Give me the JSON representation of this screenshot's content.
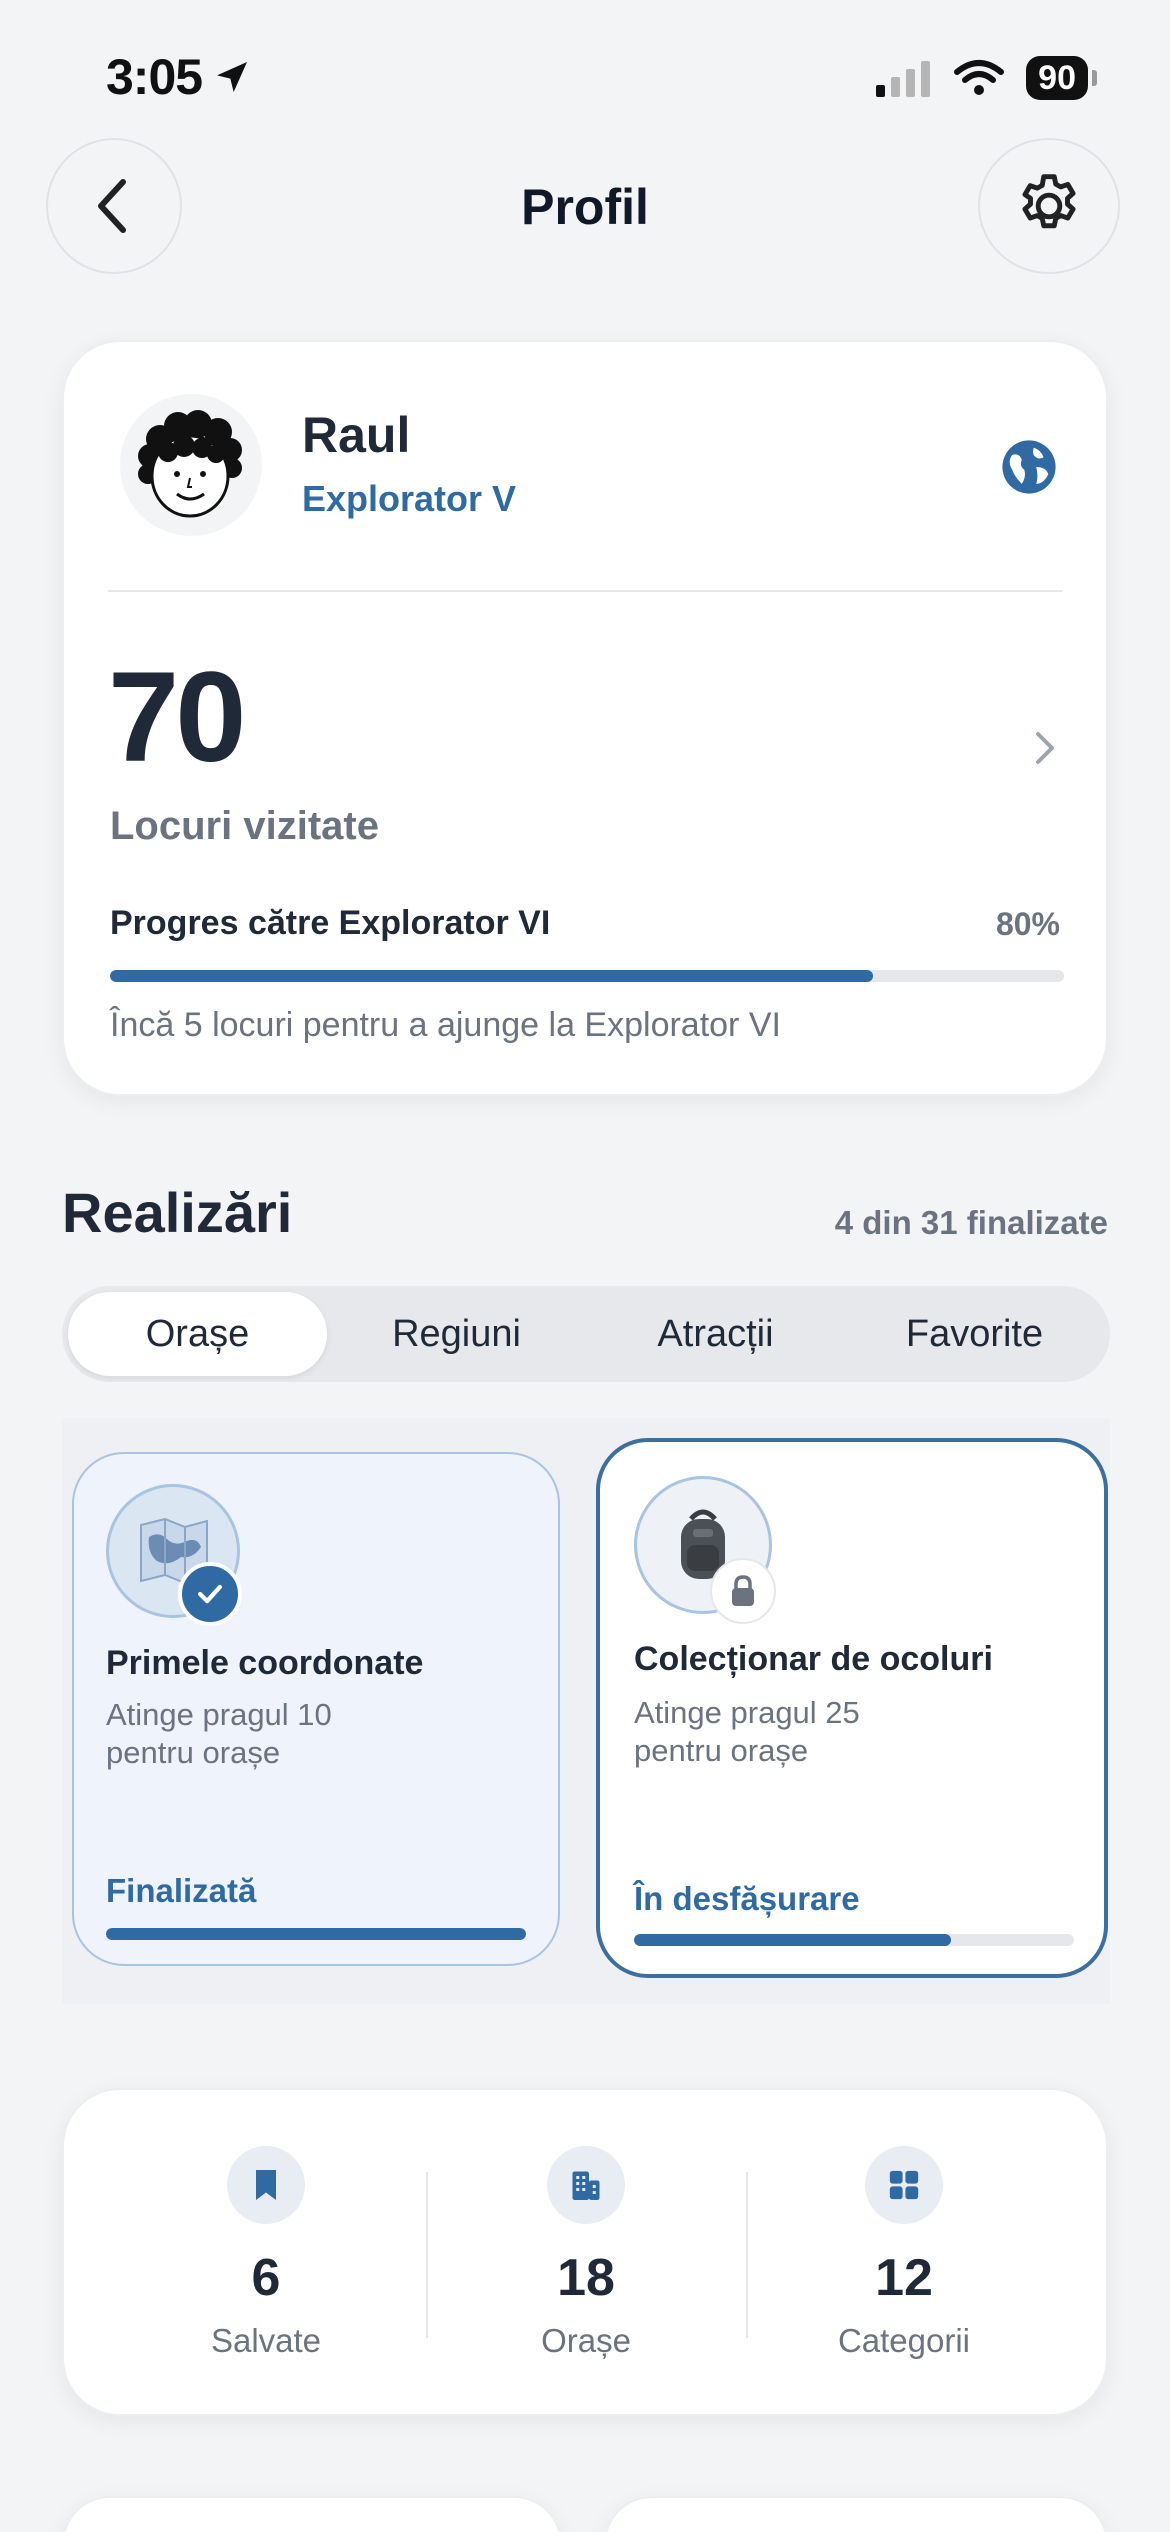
{
  "status_bar": {
    "time": "3:05",
    "battery": "90"
  },
  "header": {
    "title": "Profil"
  },
  "profile": {
    "name": "Raul",
    "level": "Explorator V",
    "visited_count": "70",
    "visited_label": "Locuri vizitate",
    "progress_label": "Progres către Explorator VI",
    "progress_percent_text": "80%",
    "progress_value": 0.8,
    "progress_hint": "Încă 5 locuri pentru a ajunge la Explorator VI"
  },
  "achievements": {
    "title": "Realizări",
    "summary": "4 din 31 finalizate",
    "tabs": [
      {
        "label": "Orașe"
      },
      {
        "label": "Regiuni"
      },
      {
        "label": "Atracții"
      },
      {
        "label": "Favorite"
      }
    ],
    "active_tab": "Orașe",
    "cards": [
      {
        "title": "Primele coordonate",
        "desc_line1": "Atinge pragul 10",
        "desc_line2": "pentru orașe",
        "status": "Finalizată",
        "progress": 1.0
      },
      {
        "title": "Colecționar de ocoluri",
        "desc_line1": "Atinge pragul 25",
        "desc_line2": "pentru orașe",
        "status": "În desfășurare",
        "progress": 0.72
      }
    ]
  },
  "stats": [
    {
      "value": "6",
      "label": "Salvate",
      "icon": "bookmark-icon"
    },
    {
      "value": "18",
      "label": "Orașe",
      "icon": "building-icon"
    },
    {
      "value": "12",
      "label": "Categorii",
      "icon": "grid-icon"
    }
  ],
  "colors": {
    "accent": "#2f6aa3",
    "background": "#f3f4f6"
  }
}
